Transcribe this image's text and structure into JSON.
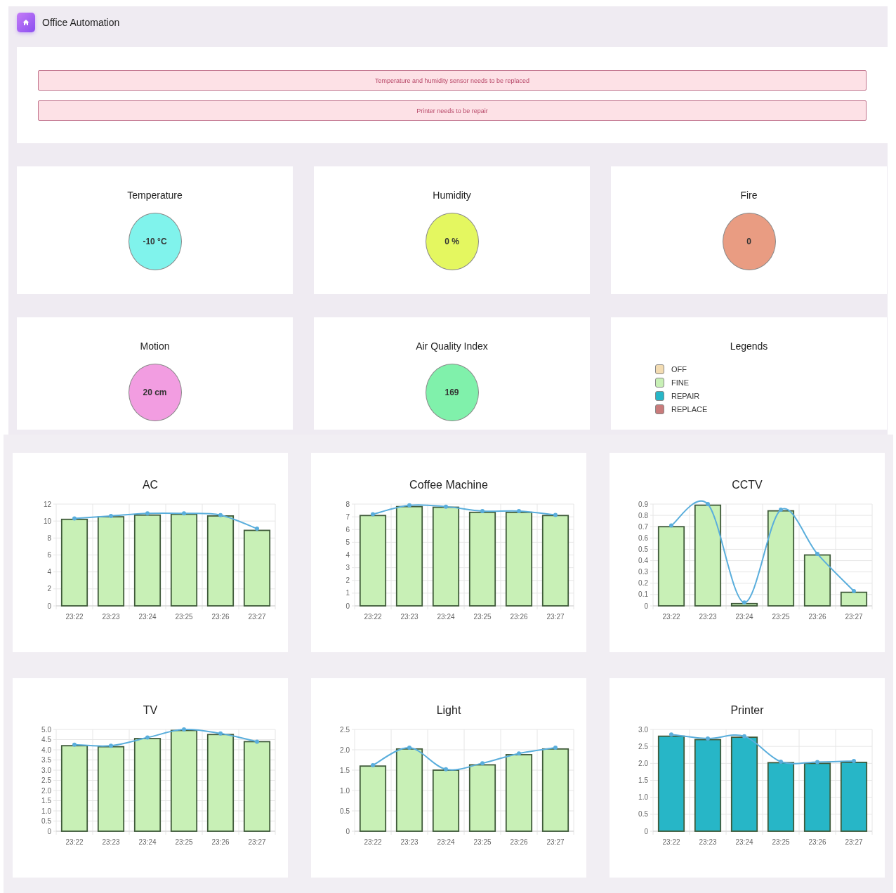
{
  "header": {
    "title": "Office Automation"
  },
  "alerts": [
    {
      "text": "Temperature and humidity sensor needs to be replaced"
    },
    {
      "text": "Printer needs to be repair"
    }
  ],
  "gauges": [
    {
      "title": "Temperature",
      "value": "-10 °C",
      "color": "#80f3ec"
    },
    {
      "title": "Humidity",
      "value": "0 %",
      "color": "#e4f760"
    },
    {
      "title": "Fire",
      "value": "0",
      "color": "#e99c82"
    },
    {
      "title": "Motion",
      "value": "20 cm",
      "color": "#f29de1"
    },
    {
      "title": "Air Quality Index",
      "value": "169",
      "color": "#80f1ab"
    }
  ],
  "legend": {
    "title": "Legends",
    "items": [
      {
        "label": "OFF",
        "color": "#f3dcb2"
      },
      {
        "label": "FINE",
        "color": "#c8f0b6"
      },
      {
        "label": "REPAIR",
        "color": "#27b6c7"
      },
      {
        "label": "REPLACE",
        "color": "#c97b7b"
      }
    ]
  },
  "charts": [
    {
      "title": "AC",
      "chart_data": {
        "type": "bar",
        "grid": true,
        "categories": [
          "23:22",
          "23:23",
          "23:24",
          "23:25",
          "23:26",
          "23:27"
        ],
        "ylim": [
          0,
          12
        ],
        "yticks": [
          0,
          2,
          4,
          6,
          8,
          10,
          12
        ],
        "series": [
          {
            "color": "#c8f0b6",
            "values": [
              10.2,
              10.5,
              10.7,
              10.8,
              10.6,
              8.9
            ]
          },
          {
            "type": "line",
            "marker": "circle",
            "color": "#5aaedc",
            "values": [
              10.3,
              10.6,
              10.9,
              10.9,
              10.7,
              9.1
            ]
          }
        ]
      }
    },
    {
      "title": "Coffee Machine",
      "chart_data": {
        "type": "bar",
        "grid": true,
        "categories": [
          "23:22",
          "23:23",
          "23:24",
          "23:25",
          "23:26",
          "23:27"
        ],
        "ylim": [
          0,
          8
        ],
        "yticks": [
          0,
          1,
          2,
          3,
          4,
          5,
          6,
          7,
          8
        ],
        "series": [
          {
            "color": "#c8f0b6",
            "values": [
              7.1,
              7.8,
              7.75,
              7.35,
              7.35,
              7.1
            ]
          },
          {
            "type": "line",
            "marker": "circle",
            "color": "#5aaedc",
            "values": [
              7.2,
              7.9,
              7.8,
              7.45,
              7.45,
              7.15
            ]
          }
        ]
      }
    },
    {
      "title": "CCTV",
      "chart_data": {
        "type": "bar",
        "grid": true,
        "categories": [
          "23:22",
          "23:23",
          "23:24",
          "23:25",
          "23:26",
          "23:27"
        ],
        "ylim": [
          0,
          0.9
        ],
        "yticks": [
          0,
          0.1,
          0.2,
          0.3,
          0.4,
          0.5,
          0.6,
          0.7,
          0.8,
          0.9
        ],
        "series": [
          {
            "color": "#c8f0b6",
            "values": [
              0.7,
              0.89,
              0.02,
              0.84,
              0.45,
              0.12
            ]
          },
          {
            "type": "line",
            "marker": "circle",
            "color": "#5aaedc",
            "values": [
              0.71,
              0.9,
              0.03,
              0.85,
              0.46,
              0.13
            ]
          }
        ]
      }
    },
    {
      "title": "TV",
      "chart_data": {
        "type": "bar",
        "grid": true,
        "categories": [
          "23:22",
          "23:23",
          "23:24",
          "23:25",
          "23:26",
          "23:27"
        ],
        "ylim": [
          0,
          5
        ],
        "yticks": [
          0,
          {
            "value": 0.5,
            "label": "0.5"
          },
          {
            "value": 1,
            "label": "1.0"
          },
          {
            "value": 1.5,
            "label": "1.5"
          },
          {
            "value": 2,
            "label": "2.0"
          },
          {
            "value": 2.5,
            "label": "2.5"
          },
          {
            "value": 3,
            "label": "3.0"
          },
          {
            "value": 3.5,
            "label": "3.5"
          },
          {
            "value": 4,
            "label": "4.0"
          },
          {
            "value": 4.5,
            "label": "4.5"
          },
          {
            "value": 5,
            "label": "5.0"
          }
        ],
        "series": [
          {
            "color": "#c8f0b6",
            "values": [
              4.2,
              4.15,
              4.55,
              4.95,
              4.75,
              4.4
            ]
          },
          {
            "type": "line",
            "marker": "circle",
            "color": "#5aaedc",
            "values": [
              4.25,
              4.2,
              4.6,
              5.0,
              4.8,
              4.4
            ]
          }
        ]
      }
    },
    {
      "title": "Light",
      "chart_data": {
        "type": "bar",
        "grid": true,
        "categories": [
          "23:22",
          "23:23",
          "23:24",
          "23:25",
          "23:26",
          "23:27"
        ],
        "ylim": [
          0,
          2.5
        ],
        "yticks": [
          0,
          {
            "value": 0.5,
            "label": "0.5"
          },
          {
            "value": 1,
            "label": "1.0"
          },
          {
            "value": 1.5,
            "label": "1.5"
          },
          {
            "value": 2,
            "label": "2.0"
          },
          {
            "value": 2.5,
            "label": "2.5"
          }
        ],
        "series": [
          {
            "color": "#c8f0b6",
            "values": [
              1.6,
              2.02,
              1.5,
              1.63,
              1.88,
              2.02
            ]
          },
          {
            "type": "line",
            "marker": "circle",
            "color": "#5aaedc",
            "values": [
              1.62,
              2.05,
              1.52,
              1.67,
              1.91,
              2.05
            ]
          }
        ]
      }
    },
    {
      "title": "Printer",
      "chart_data": {
        "type": "bar",
        "grid": true,
        "categories": [
          "23:22",
          "23:23",
          "23:24",
          "23:25",
          "23:26",
          "23:27"
        ],
        "ylim": [
          0,
          3
        ],
        "yticks": [
          0,
          {
            "value": 0.5,
            "label": "0.5"
          },
          {
            "value": 1,
            "label": "1.0"
          },
          {
            "value": 1.5,
            "label": "1.5"
          },
          {
            "value": 2,
            "label": "2.0"
          },
          {
            "value": 2.5,
            "label": "2.5"
          },
          {
            "value": 3,
            "label": "3.0"
          }
        ],
        "series": [
          {
            "color": "#27b6c7",
            "values": [
              2.8,
              2.7,
              2.77,
              2.02,
              2.0,
              2.03
            ]
          },
          {
            "type": "line",
            "marker": "circle",
            "color": "#5aaedc",
            "values": [
              2.85,
              2.73,
              2.8,
              2.05,
              2.04,
              2.07
            ]
          }
        ]
      }
    }
  ]
}
